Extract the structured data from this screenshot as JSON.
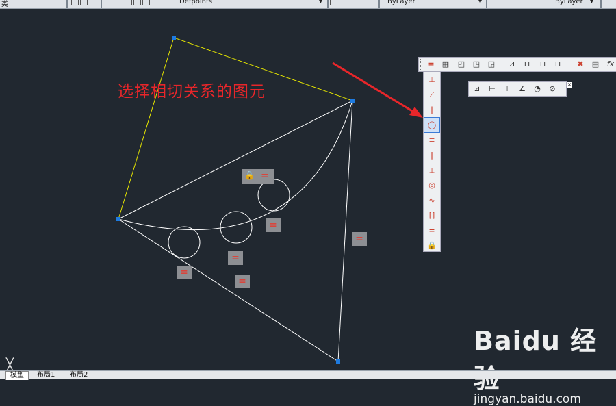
{
  "topbar": {
    "left_text": "类",
    "layer_name": "Defpoints",
    "color_value": "ByLayer",
    "linetype_value": "ByLayer"
  },
  "annotation": {
    "text": "选择相切关系的图元"
  },
  "geometric_toolbar": {
    "buttons": [
      "coincident",
      "collinear",
      "parallel",
      "tangent",
      "horizontal-constraint",
      "symmetric",
      "perpendicular",
      "concentric",
      "smooth",
      "vertical-constraint",
      "equal",
      "fix"
    ]
  },
  "parametric_toolbar": {
    "buttons": [
      "auto-constrain",
      "linear",
      "aligned",
      "horizontal",
      "vertical",
      "angular",
      "radius",
      "diameter",
      "delete-constraints",
      "param-manager",
      "fx"
    ]
  },
  "floating_toolbar": {
    "buttons": [
      "aligned",
      "horizontal",
      "vertical",
      "angular",
      "radius",
      "diameter"
    ],
    "close": "×"
  },
  "constraint_badges": {
    "equal_symbol": "="
  },
  "tabs": {
    "model": "模型",
    "layout1": "布局1",
    "layout2": "布局2"
  },
  "watermark": {
    "logo": "Baidu 经验",
    "url": "jingyan.baidu.com"
  },
  "colors": {
    "background": "#212830",
    "yellow_line": "#e6e600",
    "white_line": "#ffffff",
    "grip": "#1e7be0",
    "arrow": "#e8262a"
  }
}
